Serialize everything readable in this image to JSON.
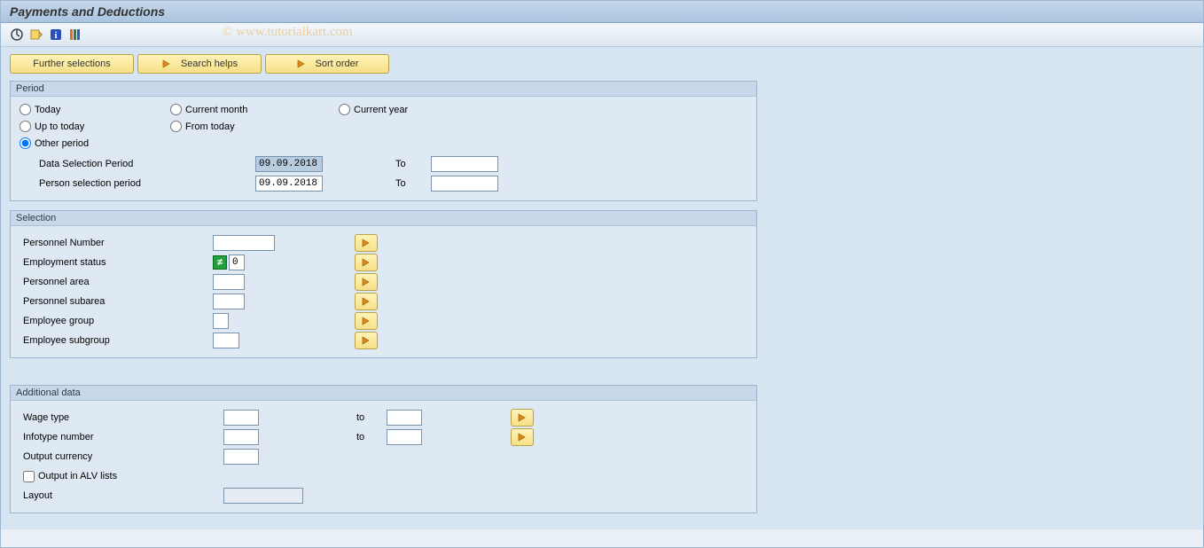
{
  "title": "Payments and Deductions",
  "watermark": "© www.tutorialkart.com",
  "action_buttons": {
    "further_selections": "Further selections",
    "search_helps": "Search helps",
    "sort_order": "Sort order"
  },
  "period": {
    "legend": "Period",
    "radios": {
      "today": "Today",
      "current_month": "Current month",
      "current_year": "Current year",
      "up_to_today": "Up to today",
      "from_today": "From today",
      "other_period": "Other period"
    },
    "data_selection_label": "Data Selection Period",
    "data_selection_from": "09.09.2018",
    "data_selection_to": "",
    "person_selection_label": "Person selection period",
    "person_selection_from": "09.09.2018",
    "person_selection_to": "",
    "to_label": "To"
  },
  "selection": {
    "legend": "Selection",
    "rows": {
      "personnel_number": {
        "label": "Personnel Number",
        "value": ""
      },
      "employment_status": {
        "label": "Employment status",
        "value": "0"
      },
      "personnel_area": {
        "label": "Personnel area",
        "value": ""
      },
      "personnel_subarea": {
        "label": "Personnel subarea",
        "value": ""
      },
      "employee_group": {
        "label": "Employee group",
        "value": ""
      },
      "employee_subgroup": {
        "label": "Employee subgroup",
        "value": ""
      }
    }
  },
  "additional": {
    "legend": "Additional data",
    "wage_type_label": "Wage type",
    "wage_type_from": "",
    "wage_type_to": "",
    "infotype_label": "Infotype number",
    "infotype_from": "",
    "infotype_to": "",
    "output_currency_label": "Output currency",
    "output_currency": "",
    "output_alv_label": "Output in ALV lists",
    "layout_label": "Layout",
    "layout": "",
    "to_label": "to"
  }
}
